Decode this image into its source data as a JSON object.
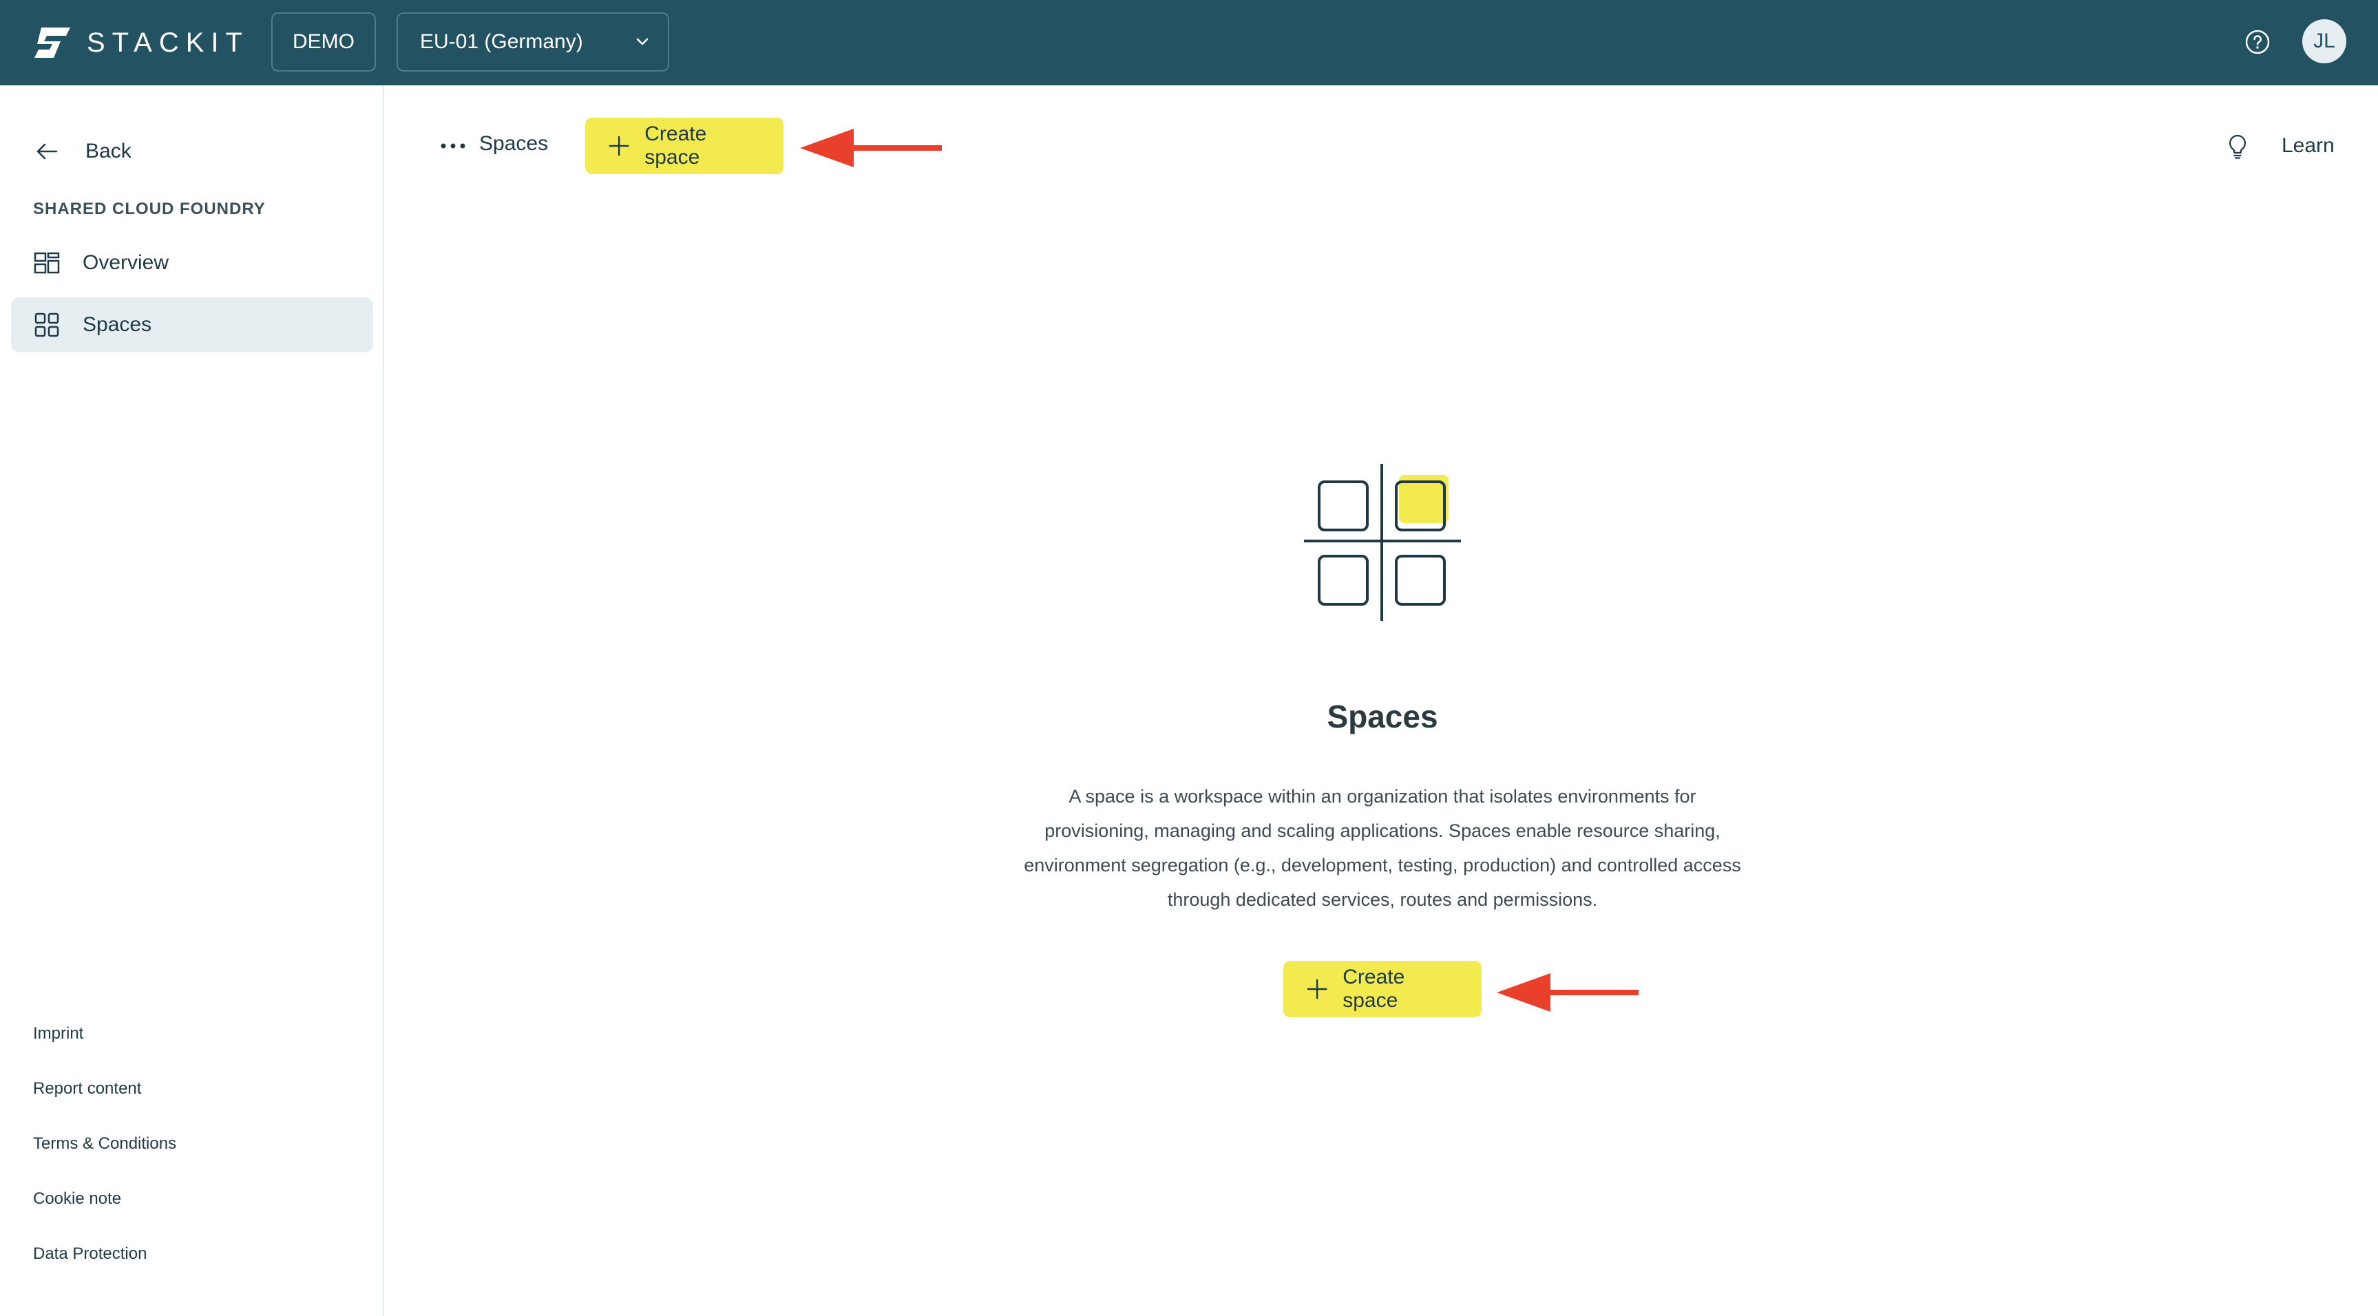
{
  "header": {
    "brand": "STACKIT",
    "environment": "DEMO",
    "region": "EU-01 (Germany)",
    "user_initials": "JL",
    "icons": [
      "stackit-logo-icon",
      "chevron-down-icon",
      "help-icon"
    ]
  },
  "sidebar": {
    "back_label": "Back",
    "section": "SHARED CLOUD FOUNDRY",
    "items": [
      {
        "label": "Overview",
        "icon": "overview-grid-icon",
        "active": false
      },
      {
        "label": "Spaces",
        "icon": "spaces-grid-icon",
        "active": true
      }
    ],
    "footer": [
      "Imprint",
      "Report content",
      "Terms & Conditions",
      "Cookie note",
      "Data Protection"
    ]
  },
  "main": {
    "breadcrumb": "Spaces",
    "create_button": "Create space",
    "learn_label": "Learn",
    "empty_state": {
      "title": "Spaces",
      "description": "A space is a workspace within an organization that isolates environments for provisioning, managing and scaling applications. Spaces enable resource sharing, environment segregation (e.g., development, testing, production) and controlled access through dedicated services, routes and permissions.",
      "button": "Create space"
    }
  },
  "colors": {
    "header_bg": "#235363",
    "accent_yellow": "#f2ea4f",
    "annotation_arrow": "#e8402a",
    "active_nav_bg": "#e6eef1"
  }
}
